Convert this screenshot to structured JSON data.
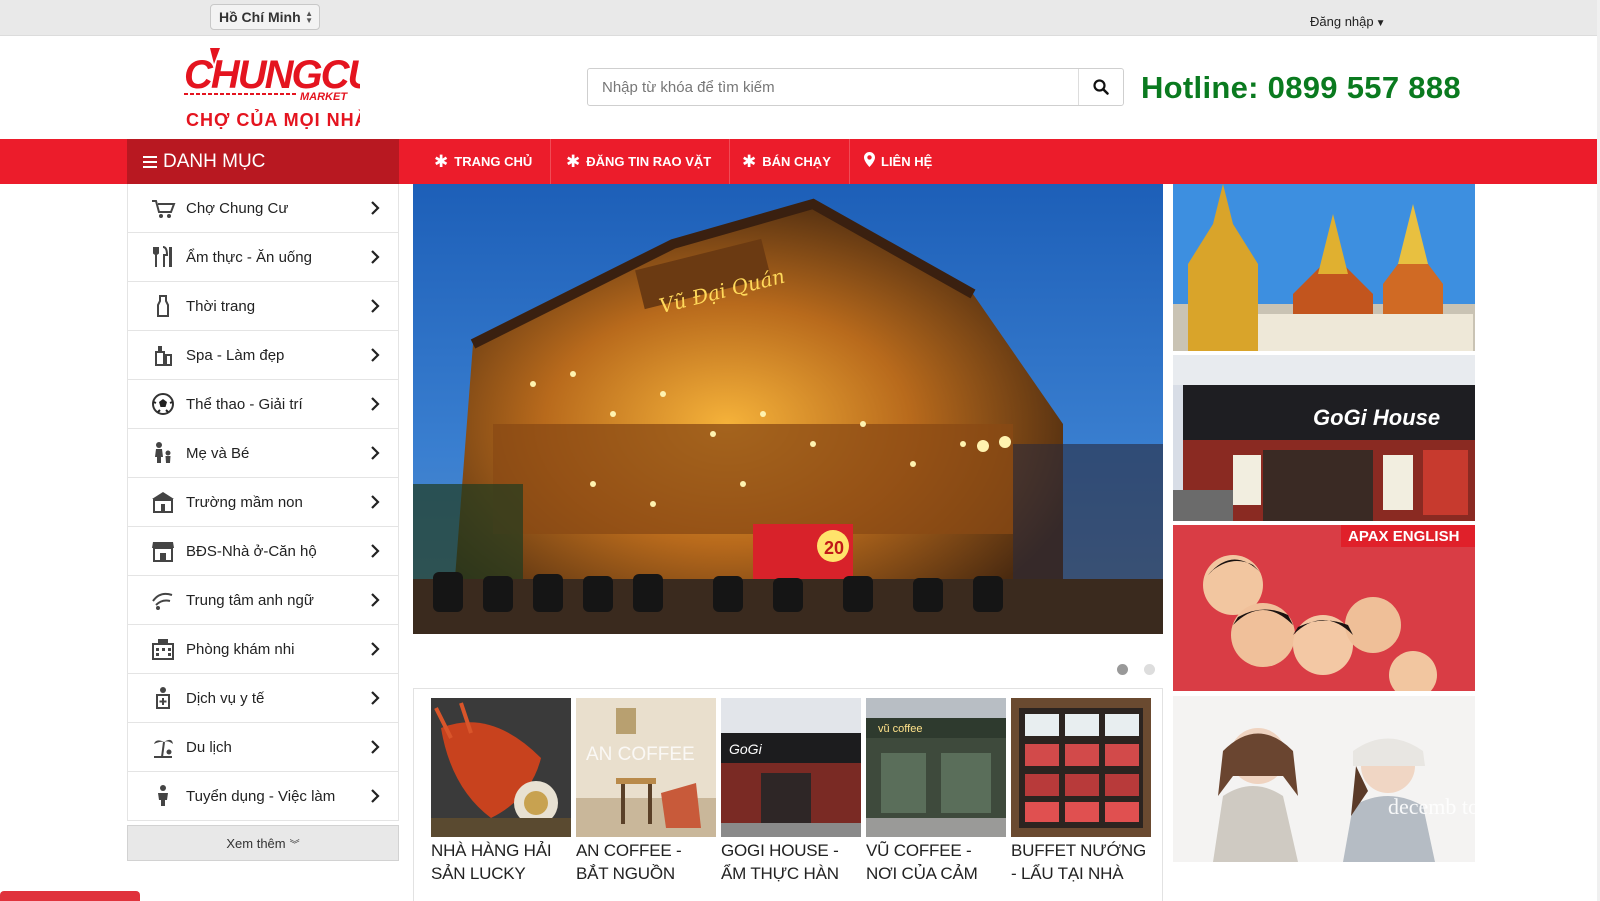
{
  "topbar": {
    "city": "Hồ Chí Minh",
    "login": "Đăng nhập"
  },
  "header": {
    "logo_main": "CHUNGCU",
    "logo_sub": "MARKET",
    "logo_tagline": "CHỢ CỦA MỌI NHÀ",
    "search_placeholder": "Nhập từ khóa để tìm kiếm",
    "hotline": "Hotline: 0899 557 888"
  },
  "nav": {
    "menu_title": "DANH MỤC",
    "items": [
      {
        "label": "TRANG CHỦ",
        "icon": "asterisk-icon"
      },
      {
        "label": "ĐĂNG TIN RAO VẶT",
        "icon": "asterisk-icon"
      },
      {
        "label": "BÁN CHẠY",
        "icon": "asterisk-icon"
      },
      {
        "label": "LIÊN HỆ",
        "icon": "map-marker-icon"
      }
    ]
  },
  "categories": [
    {
      "label": "Chợ Chung Cư",
      "icon": "shopping-cart-icon"
    },
    {
      "label": "Ẩm thực - Ăn uống",
      "icon": "cutlery-icon"
    },
    {
      "label": "Thời trang",
      "icon": "clothing-icon"
    },
    {
      "label": "Spa - Làm đẹp",
      "icon": "cosmetics-icon"
    },
    {
      "label": "Thể thao - Giải trí",
      "icon": "soccer-ball-icon"
    },
    {
      "label": "Mẹ và Bé",
      "icon": "mother-baby-icon"
    },
    {
      "label": "Trường mầm non",
      "icon": "school-icon"
    },
    {
      "label": "BĐS-Nhà ở-Căn hộ",
      "icon": "store-icon"
    },
    {
      "label": "Trung tâm anh ngữ",
      "icon": "language-icon"
    },
    {
      "label": "Phòng khám nhi",
      "icon": "clinic-icon"
    },
    {
      "label": "Dịch vụ y tế",
      "icon": "medical-icon"
    },
    {
      "label": "Du lịch",
      "icon": "travel-icon"
    },
    {
      "label": "Tuyển dụng - Việc làm",
      "icon": "recruitment-icon"
    }
  ],
  "see_more": "Xem thêm",
  "hero": {
    "sign_text": "Vũ Đại Quán",
    "banner_text": "20",
    "active_slide": 1,
    "slide_count": 2
  },
  "side_banners": [
    {
      "label": "",
      "caption": ""
    },
    {
      "label": "GoGi House",
      "caption": ""
    },
    {
      "label": "APAX ENGLISH",
      "caption": ""
    },
    {
      "label": "",
      "caption": "decemb to reme"
    }
  ],
  "products": [
    {
      "name": "NHÀ HÀNG HẢI SẢN LUCKY",
      "thumb_text": ""
    },
    {
      "name": "AN COFFEE - BẮT NGUỒN",
      "thumb_text": "AN COFFEE"
    },
    {
      "name": "GOGI HOUSE - ẨM THỰC HÀN",
      "thumb_text": "GoGi"
    },
    {
      "name": "VŨ COFFEE - NƠI CỦA CẢM",
      "thumb_text": "vũ coffee"
    },
    {
      "name": "BUFFET NƯỚNG - LẨU TẠI NHÀ",
      "thumb_text": ""
    }
  ],
  "colors": {
    "brand_red": "#ec1c2b",
    "dark_red": "#b81821",
    "hotline_green": "#0a7a1f"
  }
}
